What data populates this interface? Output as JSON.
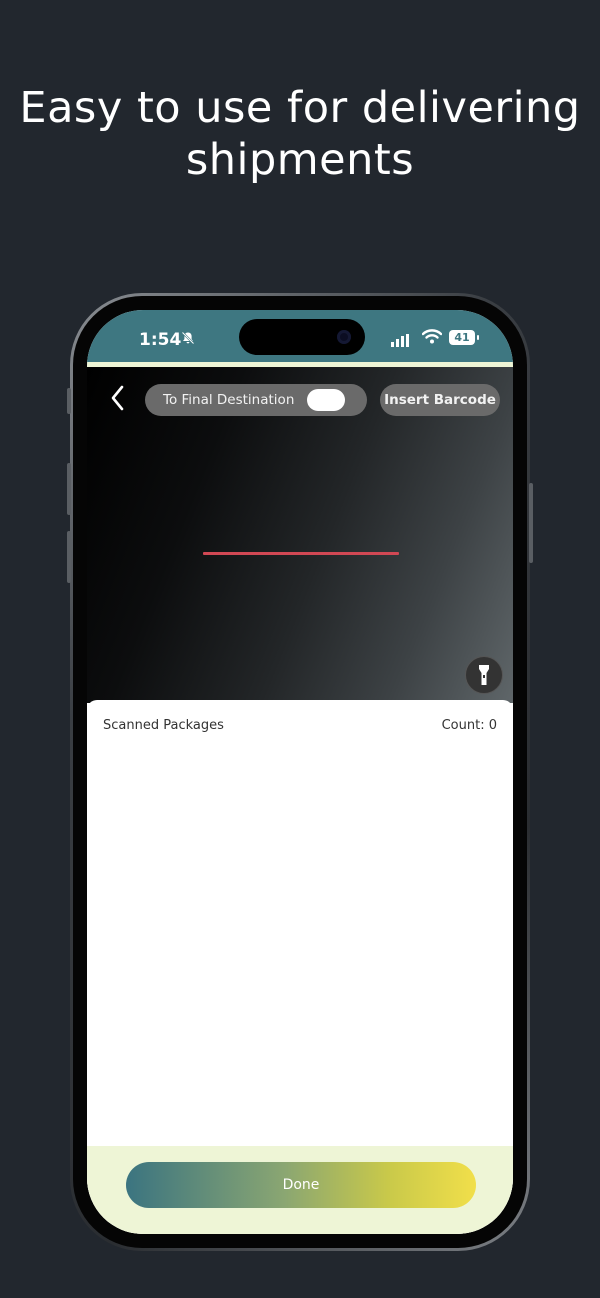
{
  "headline": {
    "line1": "Easy to use for delivering",
    "line2": "shipments"
  },
  "status_bar": {
    "time": "1:54",
    "battery": "41"
  },
  "scanner": {
    "toggle_label": "To Final Destination",
    "toggle_on": false,
    "insert_barcode_label": "Insert Barcode"
  },
  "packages": {
    "title": "Scanned Packages",
    "count_label": "Count: 0"
  },
  "footer": {
    "done_label": "Done"
  },
  "colors": {
    "background": "#22272e",
    "status_bar": "#3e7781",
    "scan_line": "#d14854",
    "footer": "#eef5d6",
    "done_gradient_start": "#3b7480",
    "done_gradient_end": "#f1df4a"
  },
  "icons": [
    "back-chevron-icon",
    "bell-slash-icon",
    "signal-icon",
    "wifi-icon",
    "battery-icon",
    "flashlight-icon"
  ]
}
